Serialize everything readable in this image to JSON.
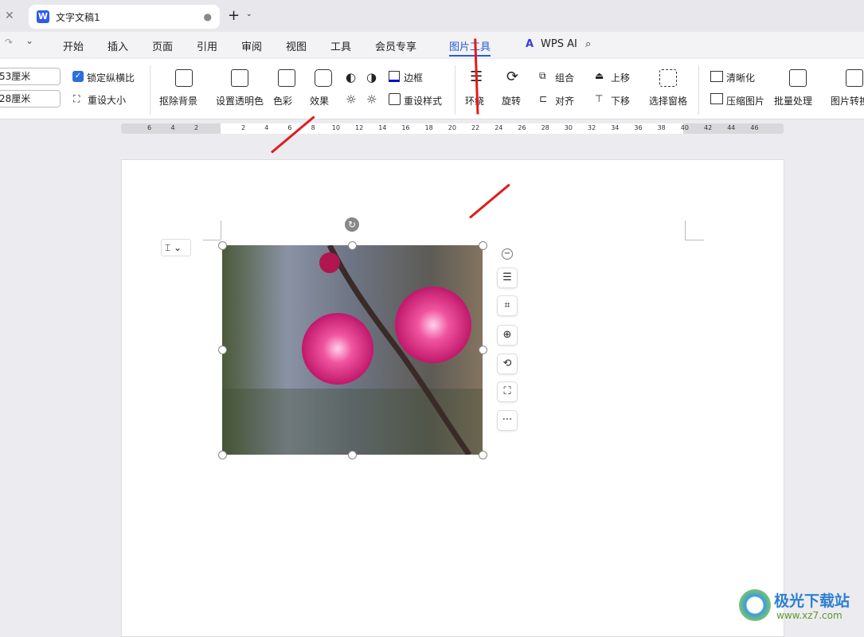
{
  "tabbar": {
    "doc_title": "文字文稿1",
    "new_tab": "+"
  },
  "menu": {
    "items": [
      "开始",
      "插入",
      "页面",
      "引用",
      "审阅",
      "视图",
      "工具",
      "会员专享",
      "图片工具"
    ],
    "active": "图片工具",
    "ai": "WPS AI"
  },
  "ribbon": {
    "width_value": "53厘米",
    "height_value": "28厘米",
    "lock_ratio": "锁定纵横比",
    "lock_checked": true,
    "reset_size": "重设大小",
    "remove_bg": "抠除背景",
    "set_transparent": "设置透明色",
    "color": "色彩",
    "effects": "效果",
    "border": "边框",
    "reset_style": "重设样式",
    "wrap": "环绕",
    "rotate": "旋转",
    "group": "组合",
    "align": "对齐",
    "bring_forward": "上移",
    "send_backward": "下移",
    "selection_pane": "选择窗格",
    "sharpen": "清晰化",
    "compress": "压缩图片",
    "batch": "批量处理",
    "convert": "图片转换"
  },
  "ruler": {
    "left_ticks": [
      "6",
      "4",
      "2"
    ],
    "ticks": [
      "2",
      "4",
      "6",
      "8",
      "10",
      "12",
      "14",
      "16",
      "18",
      "20",
      "22",
      "24",
      "26",
      "28",
      "30",
      "32",
      "34",
      "36",
      "38",
      "40",
      "42",
      "44",
      "46"
    ]
  },
  "watermark": {
    "name": "极光下载站",
    "url": "www.xz7.com"
  },
  "colors": {
    "accent": "#2a5bd7",
    "annotation_arrow": "#e01b1b"
  }
}
